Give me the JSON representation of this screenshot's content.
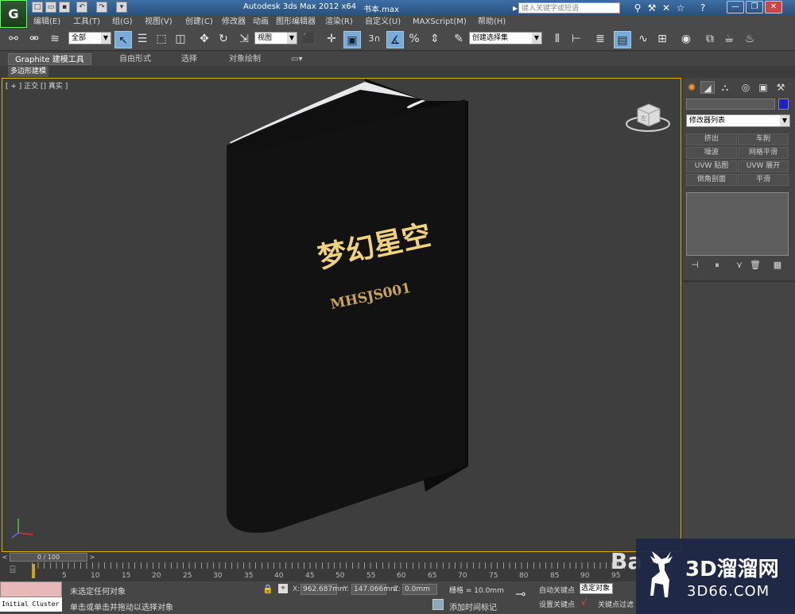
{
  "titlebar": {
    "app_logo": "G",
    "title": "Autodesk 3ds Max  2012 x64",
    "file": "书本.max",
    "search_placeholder": "键入关键字或短语",
    "window_buttons": [
      "—",
      "❐",
      "✕"
    ]
  },
  "menu": [
    "编辑(E)",
    "工具(T)",
    "组(G)",
    "视图(V)",
    "创建(C)",
    "修改器",
    "动画",
    "图形编辑器",
    "渲染(R)",
    "自定义(U)",
    "MAXScript(M)",
    "帮助(H)"
  ],
  "toolbar": {
    "selection_filter": "全部",
    "reference_coord": "视图",
    "snap_label": "3",
    "named_selection": "创建选择集"
  },
  "ribbon": {
    "tabs": [
      "Graphite 建模工具",
      "自由形式",
      "选择",
      "对象绘制"
    ],
    "panel": "多边形建模"
  },
  "viewport": {
    "label": "[ + ] 正交 [] 真实 ]",
    "book_title": "梦幻星空",
    "book_code": "MHSJS001",
    "viewcube_label": "左"
  },
  "command_panel": {
    "modifier_list": "修改器列表",
    "buttons": [
      "挤出",
      "车削",
      "噪波",
      "网格平滑",
      "UVW 贴图",
      "UVW 展开",
      "倒角剖面",
      "平滑"
    ]
  },
  "timeline": {
    "frame": "0 / 100",
    "ticks": [
      "5",
      "10",
      "15",
      "20",
      "25",
      "30",
      "35",
      "40",
      "45",
      "50",
      "55",
      "60",
      "65",
      "70",
      "75",
      "80",
      "85",
      "90",
      "95"
    ]
  },
  "status": {
    "cluster": "Initial Cluster",
    "message1": "未选定任何对象",
    "message2": "单击或单击并拖动以选择对象",
    "x_label": "X:",
    "x_value": "962.687mm",
    "y_label": "Y:",
    "y_value": "147.066mm",
    "z_label": "Z:",
    "z_value": "0.0mm",
    "grid": "栅格 = 10.0mm",
    "add_time_tag": "添加时间标记",
    "auto_key": "自动关键点",
    "set_key": "设置关键点",
    "selection_set": "选定对象",
    "key_filter": "关键点过滤"
  },
  "watermark": {
    "bai": "Ba",
    "brand": "3D溜溜网",
    "url": "3D66.COM"
  }
}
